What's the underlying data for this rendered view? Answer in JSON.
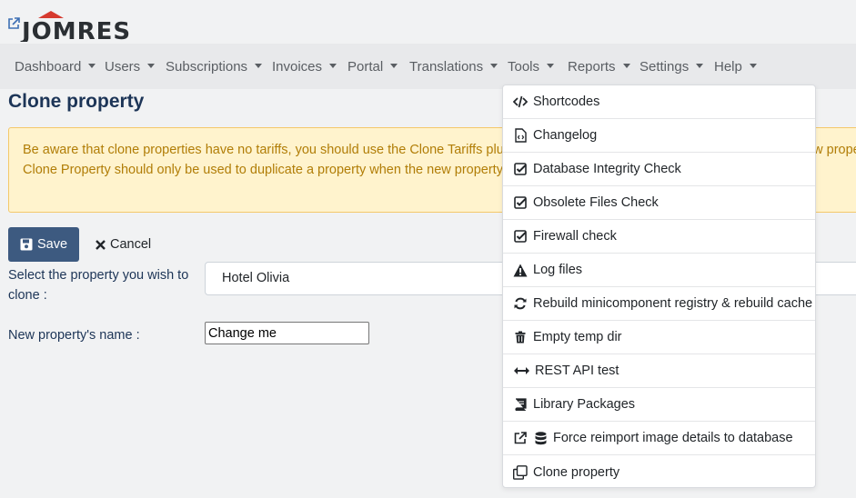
{
  "logo": {
    "text": "JOMRES"
  },
  "nav": [
    {
      "label": "Dashboard"
    },
    {
      "label": "Users"
    },
    {
      "label": "Subscriptions"
    },
    {
      "label": "Invoices"
    },
    {
      "label": "Portal"
    },
    {
      "label": "Translations"
    },
    {
      "label": "Tools"
    },
    {
      "label": "Reports"
    },
    {
      "label": "Settings"
    },
    {
      "label": "Help"
    }
  ],
  "page": {
    "title": "Clone property"
  },
  "alert": {
    "line1": "Be aware that clone properties have no tariffs, you should use the Clone Tariffs plugin or create tariffs for the new property manually. New property also have no managers.",
    "line2": "Clone Property should only be used to duplicate a property when the new property will be of the same property type and room type."
  },
  "buttons": {
    "save": "Save",
    "cancel": "Cancel"
  },
  "form": {
    "select_label": "Select the property you wish to clone :",
    "select_value": "Hotel Olivia",
    "name_label": "New property's name :",
    "name_value": "Change me"
  },
  "tools_menu": [
    {
      "label": "Shortcodes",
      "icon": "code-icon"
    },
    {
      "label": "Changelog",
      "icon": "file-code-icon"
    },
    {
      "label": "Database Integrity Check",
      "icon": "check-square-icon"
    },
    {
      "label": "Obsolete Files Check",
      "icon": "check-square-icon"
    },
    {
      "label": "Firewall check",
      "icon": "check-square-icon"
    },
    {
      "label": "Log files",
      "icon": "warning-icon"
    },
    {
      "label": "Rebuild minicomponent registry & rebuild cache",
      "icon": "refresh-icon"
    },
    {
      "label": "Empty temp dir",
      "icon": "trash-icon"
    },
    {
      "label": "REST API test",
      "icon": "arrows-h-icon"
    },
    {
      "label": "Library Packages",
      "icon": "book-icon"
    },
    {
      "label": "Force reimport image details to database",
      "icon": "database-icon"
    },
    {
      "label": "Clone property",
      "icon": "clone-icon"
    }
  ],
  "colors": {
    "title": "#1d3557",
    "save_button": "#3d5a80",
    "alert_bg": "#fff3cd",
    "alert_text": "#b17d07",
    "logo_red": "#d63a2f"
  }
}
